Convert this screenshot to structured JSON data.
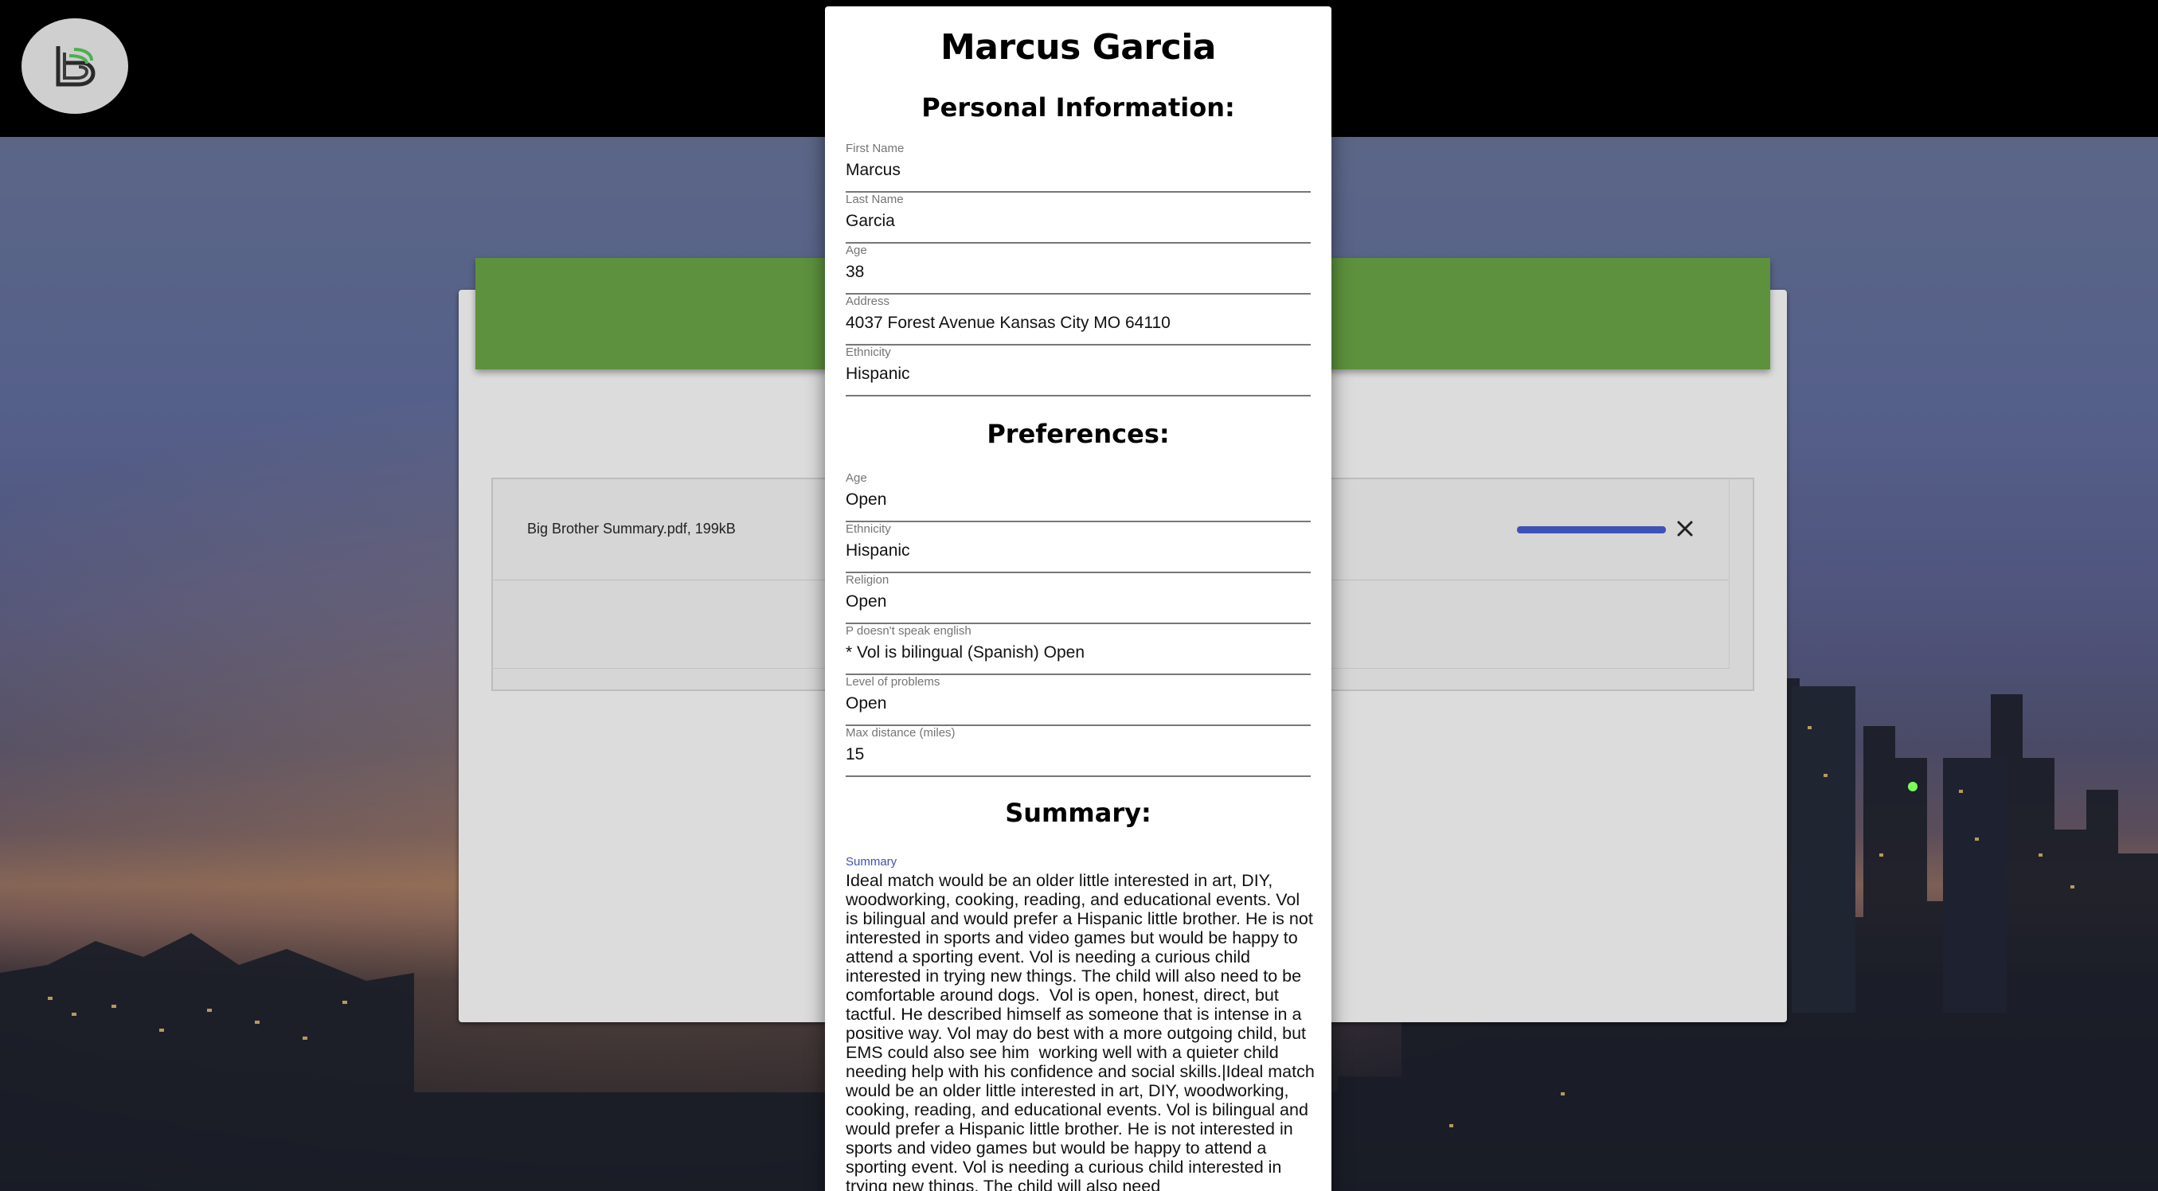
{
  "profile": {
    "name": "Marcus Garcia"
  },
  "sections": {
    "personal": "Personal Information:",
    "preferences": "Preferences:",
    "summary": "Summary:"
  },
  "personal": [
    {
      "label": "First Name",
      "value": "Marcus"
    },
    {
      "label": "Last Name",
      "value": "Garcia"
    },
    {
      "label": "Age",
      "value": "38"
    },
    {
      "label": "Address",
      "value": "4037 Forest Avenue Kansas City MO 64110"
    },
    {
      "label": "Ethnicity",
      "value": "Hispanic"
    }
  ],
  "preferences": [
    {
      "label": "Age",
      "value": "Open"
    },
    {
      "label": "Ethnicity",
      "value": "Hispanic"
    },
    {
      "label": "Religion",
      "value": "Open"
    },
    {
      "label": "P doesn't speak english",
      "value": "* Vol is bilingual (Spanish)  Open"
    },
    {
      "label": "Level of problems",
      "value": "Open"
    },
    {
      "label": "Max distance (miles)",
      "value": "15"
    }
  ],
  "summary": {
    "label": "Summary",
    "text": "Ideal match would be an older little interested in art, DIY, woodworking, cooking, reading, and educational events. Vol is bilingual and would prefer a Hispanic little brother. He is not interested in sports and video games but would be happy to attend a sporting event. Vol is needing a curious child interested in trying new things. The child will also need to be comfortable around dogs.  Vol is open, honest, direct, but tactful. He described himself as someone that is intense in a positive way. Vol may do best with a more outgoing child, but EMS could also see him  working well with a quieter child needing help with his confidence and social skills.|Ideal match would be an older little interested in art, DIY, woodworking, cooking, reading, and educational events. Vol is bilingual and would prefer a Hispanic little brother. He is not interested in sports and video games but would be happy to attend a sporting event. Vol is needing a curious child interested in trying new things. The child will also need"
  },
  "upload": {
    "file_name": "Big Brother Summary.pdf, 199kB",
    "progress": 1.0
  },
  "colors": {
    "accent": "#3f51b5",
    "header_green": "#5d913d",
    "topbar": "#000000"
  },
  "icons": {
    "logo": "bbbs-logo-icon",
    "remove": "close-icon"
  }
}
